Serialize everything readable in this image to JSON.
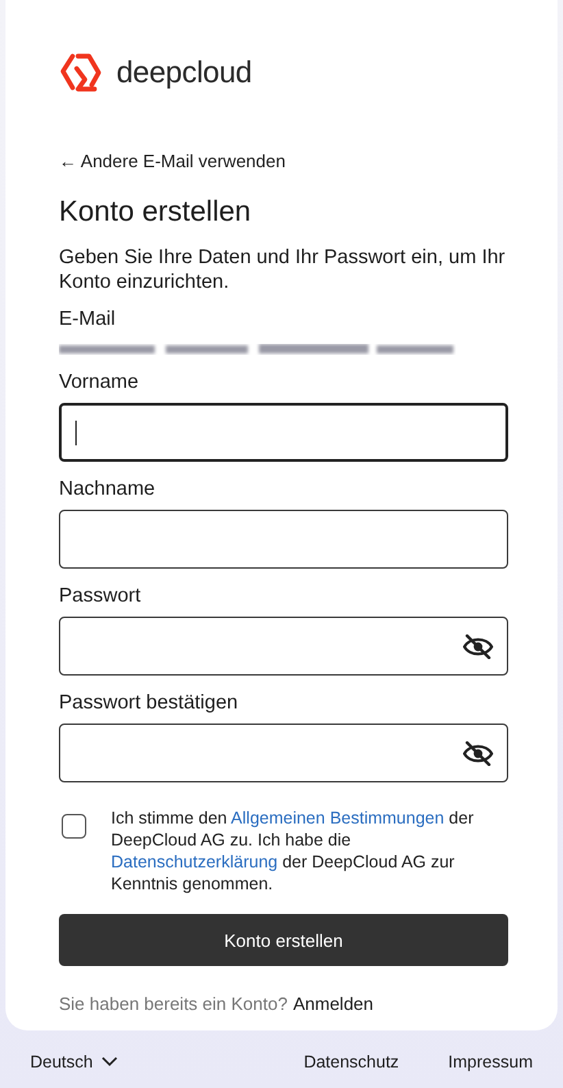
{
  "brand": {
    "name": "deepcloud"
  },
  "back_link": {
    "label": "← Andere E-Mail verwenden"
  },
  "title": "Konto erstellen",
  "description": "Geben Sie Ihre Daten und Ihr Passwort ein, um Ihr Konto einzurichten.",
  "email": {
    "label": "E-Mail"
  },
  "fields": [
    {
      "label": "Vorname",
      "kind": "text",
      "focused": true
    },
    {
      "label": "Nachname",
      "kind": "text",
      "focused": false
    },
    {
      "label": "Passwort",
      "kind": "password",
      "focused": false
    },
    {
      "label": "Passwort bestätigen",
      "kind": "password",
      "focused": false
    }
  ],
  "consent": {
    "checked": false,
    "parts": [
      {
        "kind": "text",
        "text": "Ich stimme den "
      },
      {
        "kind": "link",
        "text": "Allgemeinen Bestimmungen"
      },
      {
        "kind": "text",
        "text": " der DeepCloud AG zu. Ich habe die "
      },
      {
        "kind": "link",
        "text": "Datenschutzerklärung"
      },
      {
        "kind": "text",
        "text": " der DeepCloud AG zur Kenntnis genommen."
      }
    ]
  },
  "submit": {
    "label": "Konto erstellen"
  },
  "login_prompt": {
    "text": "Sie haben bereits ein Konto?",
    "link": "Anmelden"
  },
  "footer": {
    "language": "Deutsch",
    "links": [
      "Datenschutz",
      "Impressum"
    ]
  }
}
